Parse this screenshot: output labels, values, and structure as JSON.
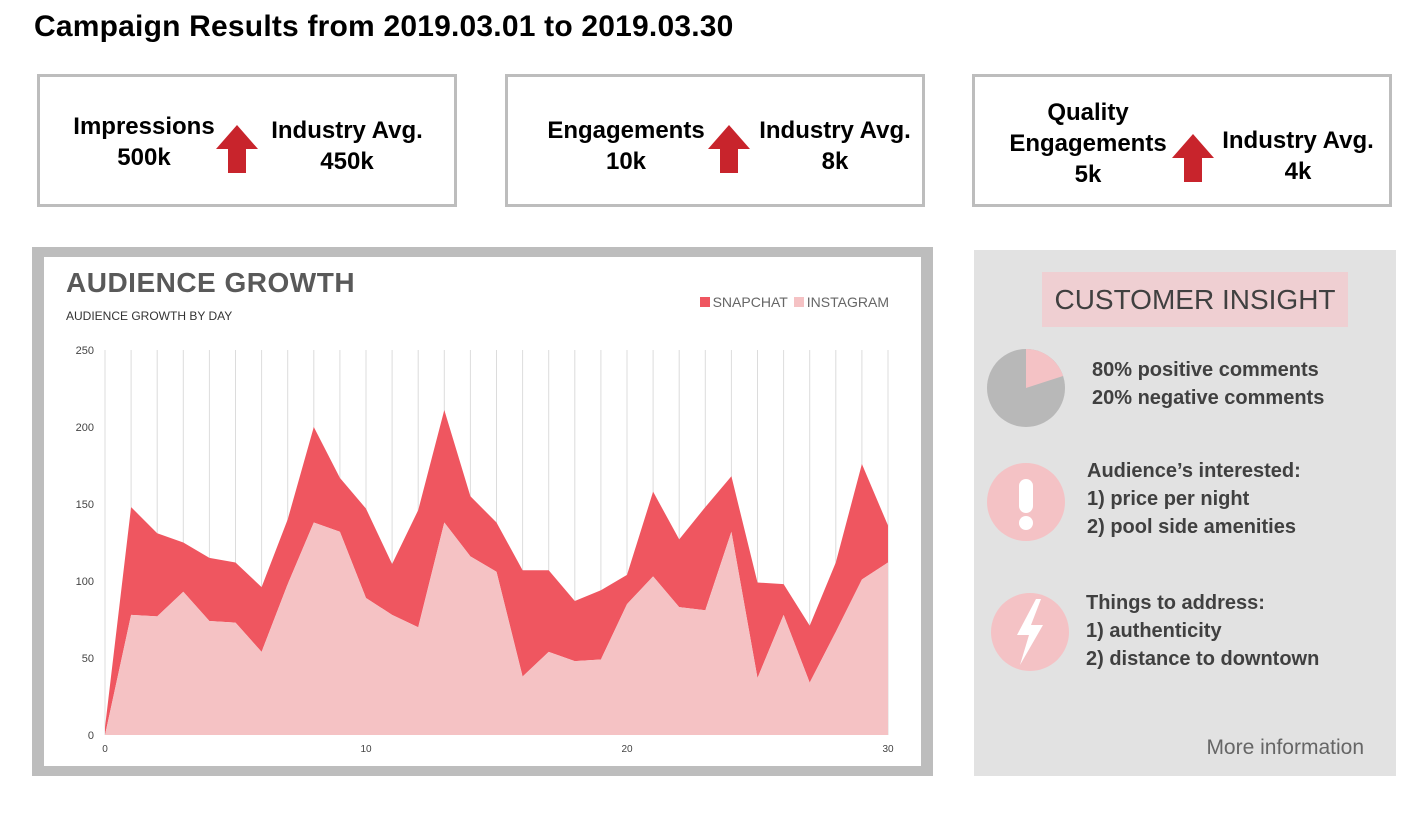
{
  "page": {
    "title": "Campaign Results from 2019.03.01 to 2019.03.30"
  },
  "kpis": [
    {
      "metric_lines": [
        "Impressions"
      ],
      "metric_value": "500k",
      "avg_label": "Industry Avg.",
      "avg_value": "450k",
      "trend": "up"
    },
    {
      "metric_lines": [
        "Engagements"
      ],
      "metric_value": "10k",
      "avg_label": "Industry Avg.",
      "avg_value": "8k",
      "trend": "up"
    },
    {
      "metric_lines": [
        "Quality",
        "Engagements"
      ],
      "metric_value": "5k",
      "avg_label": "Industry Avg.",
      "avg_value": "4k",
      "trend": "up"
    }
  ],
  "colors": {
    "snapchat": "#ef5660",
    "instagram": "#f5c2c4",
    "arrow": "#c8242c",
    "frame": "#bdbdbd",
    "panel": "#e2e2e2",
    "pie_dark": "#b8b8b8",
    "pie_light": "#f4c2c5"
  },
  "chart_data": {
    "type": "area",
    "title": "AUDIENCE GROWTH",
    "subtitle": "AUDIENCE GROWTH BY DAY",
    "stacked": true,
    "x": [
      0,
      1,
      2,
      3,
      4,
      5,
      6,
      7,
      8,
      9,
      10,
      11,
      12,
      13,
      14,
      15,
      16,
      17,
      18,
      19,
      20,
      21,
      22,
      23,
      24,
      25,
      26,
      27,
      28,
      29,
      30
    ],
    "xticks": [
      0,
      10,
      20,
      30
    ],
    "xtick_labels": [
      "0",
      "10",
      "20",
      "30"
    ],
    "ylim": [
      0,
      250
    ],
    "yticks": [
      0,
      50,
      100,
      150,
      200,
      250
    ],
    "ytick_labels": [
      "0",
      "50",
      "100",
      "150",
      "200",
      "250"
    ],
    "vertical_grid": true,
    "legend": {
      "position": "top-right",
      "entries": [
        "SNAPCHAT",
        "INSTAGRAM"
      ]
    },
    "series": [
      {
        "name": "INSTAGRAM",
        "values": [
          0,
          78,
          77,
          93,
          74,
          73,
          54,
          98,
          138,
          132,
          89,
          78,
          70,
          138,
          116,
          106,
          38,
          54,
          48,
          49,
          85,
          103,
          83,
          81,
          132,
          37,
          78,
          34,
          67,
          101,
          112
        ]
      },
      {
        "name": "SNAPCHAT",
        "values": [
          5,
          70,
          54,
          32,
          41,
          39,
          42,
          42,
          62,
          35,
          58,
          33,
          76,
          73,
          39,
          32,
          69,
          53,
          39,
          45,
          19,
          55,
          44,
          67,
          36,
          62,
          20,
          37,
          45,
          75,
          24
        ]
      }
    ]
  },
  "insight": {
    "title": "CUSTOMER INSIGHT",
    "pie": {
      "positive_pct": 80,
      "negative_pct": 20
    },
    "sentiment_lines": [
      "80% positive comments",
      "20% negative comments"
    ],
    "interest_lines": [
      "Audience’s interested:",
      "1) price per night",
      "2) pool side amenities"
    ],
    "address_lines": [
      "Things to address:",
      "1) authenticity",
      "2) distance to downtown"
    ],
    "icons": [
      "pie-chart-icon",
      "exclamation-icon",
      "lightning-icon"
    ],
    "more_link": "More information"
  }
}
